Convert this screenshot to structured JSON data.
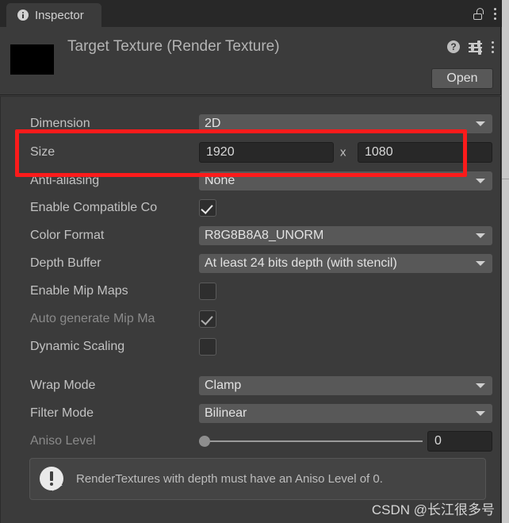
{
  "window": {
    "tab_label": "Inspector",
    "tab_icon": "info-icon",
    "lock_icon": "unlocked-padlock-icon",
    "menu_icon": "kebab-menu-icon"
  },
  "object_header": {
    "title": "Target Texture (Render Texture)",
    "thumbnail_color": "#000000",
    "help_icon": "help-question-icon",
    "help_glyph": "?",
    "presets_icon": "preset-sliders-icon",
    "menu_icon": "kebab-menu-icon",
    "open_button": "Open"
  },
  "properties": [
    {
      "name": "dimension",
      "label": "Dimension",
      "control": "dropdown",
      "value": "2D",
      "disabled": false
    },
    {
      "name": "size",
      "label": "Size",
      "control": "size",
      "width": "1920",
      "separator": "x",
      "height": "1080",
      "disabled": false
    },
    {
      "name": "anti-aliasing",
      "label": "Anti-aliasing",
      "control": "dropdown",
      "value": "None",
      "disabled": false
    },
    {
      "name": "enable-compatible-color-format",
      "label": "Enable Compatible Co",
      "control": "checkbox",
      "checked": true,
      "disabled": false
    },
    {
      "name": "color-format",
      "label": "Color Format",
      "control": "dropdown",
      "value": "R8G8B8A8_UNORM",
      "disabled": false
    },
    {
      "name": "depth-buffer",
      "label": "Depth Buffer",
      "control": "dropdown",
      "value": "At least 24 bits depth (with stencil)",
      "disabled": false
    },
    {
      "name": "enable-mip-maps",
      "label": "Enable Mip Maps",
      "control": "checkbox",
      "checked": false,
      "disabled": false
    },
    {
      "name": "auto-generate-mip-maps",
      "label": "Auto generate Mip Ma",
      "control": "checkbox",
      "checked": true,
      "disabled": true
    },
    {
      "name": "dynamic-scaling",
      "label": "Dynamic Scaling",
      "control": "checkbox",
      "checked": false,
      "disabled": false
    },
    {
      "name": "wrap-mode",
      "label": "Wrap Mode",
      "control": "dropdown",
      "value": "Clamp",
      "disabled": false
    },
    {
      "name": "filter-mode",
      "label": "Filter Mode",
      "control": "dropdown",
      "value": "Bilinear",
      "disabled": false
    },
    {
      "name": "aniso-level",
      "label": "Aniso Level",
      "control": "slider",
      "value": "0",
      "slider_percent": 0,
      "disabled": true
    }
  ],
  "warning": {
    "icon": "warning-exclamation-icon",
    "text": "RenderTextures with depth must have an Aniso Level of 0."
  },
  "annotation": {
    "type": "red-rectangle-highlight",
    "color": "#fb1b1b"
  },
  "watermark": "CSDN @长江很多号"
}
